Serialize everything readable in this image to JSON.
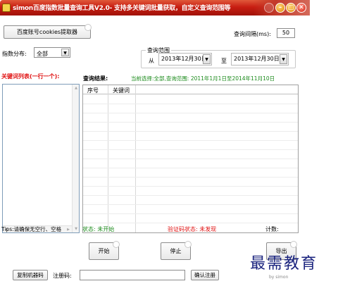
{
  "window": {
    "title": "simon百度指数批量查询工具V2.0- 支持多关键词批量获取，自定义查询范围等"
  },
  "toolbar": {
    "cookie_button": "百度账号cookies提取器",
    "interval_label": "查询间隔(ms):",
    "interval_value": "50"
  },
  "distribution": {
    "label": "指数分布:",
    "selected": "全部"
  },
  "range": {
    "legend": "查询范围",
    "from_label": "从",
    "from_date": "2013年12月30日",
    "to_label": "至",
    "to_date": "2013年12月30日"
  },
  "keywords": {
    "header": "关键词列表(一行一个):"
  },
  "results": {
    "header": "查询结果:",
    "current_selection": "当前选择:全部,查询范围: 2011年1月1日至2014年11月10日",
    "columns": [
      "序号",
      "关键词"
    ]
  },
  "status": {
    "tips": "Tips:请确保无空行、空格",
    "state": "状态: 未开始",
    "captcha_state": "验证码状态: 未发现",
    "count_label": "计数:"
  },
  "actions": {
    "start": "开始",
    "stop": "停止",
    "export": "导出"
  },
  "register": {
    "copy_machine_code": "复制机器码",
    "reg_code_label": "注册码:",
    "reg_code_value": "",
    "confirm": "确认注册"
  },
  "overlay": {
    "watermark": "最需教育",
    "watermark_sub": "by simon"
  },
  "colors": {
    "titlebar": "#c81e12",
    "red_text": "#e01010",
    "green_text": "#1a8a1a"
  }
}
